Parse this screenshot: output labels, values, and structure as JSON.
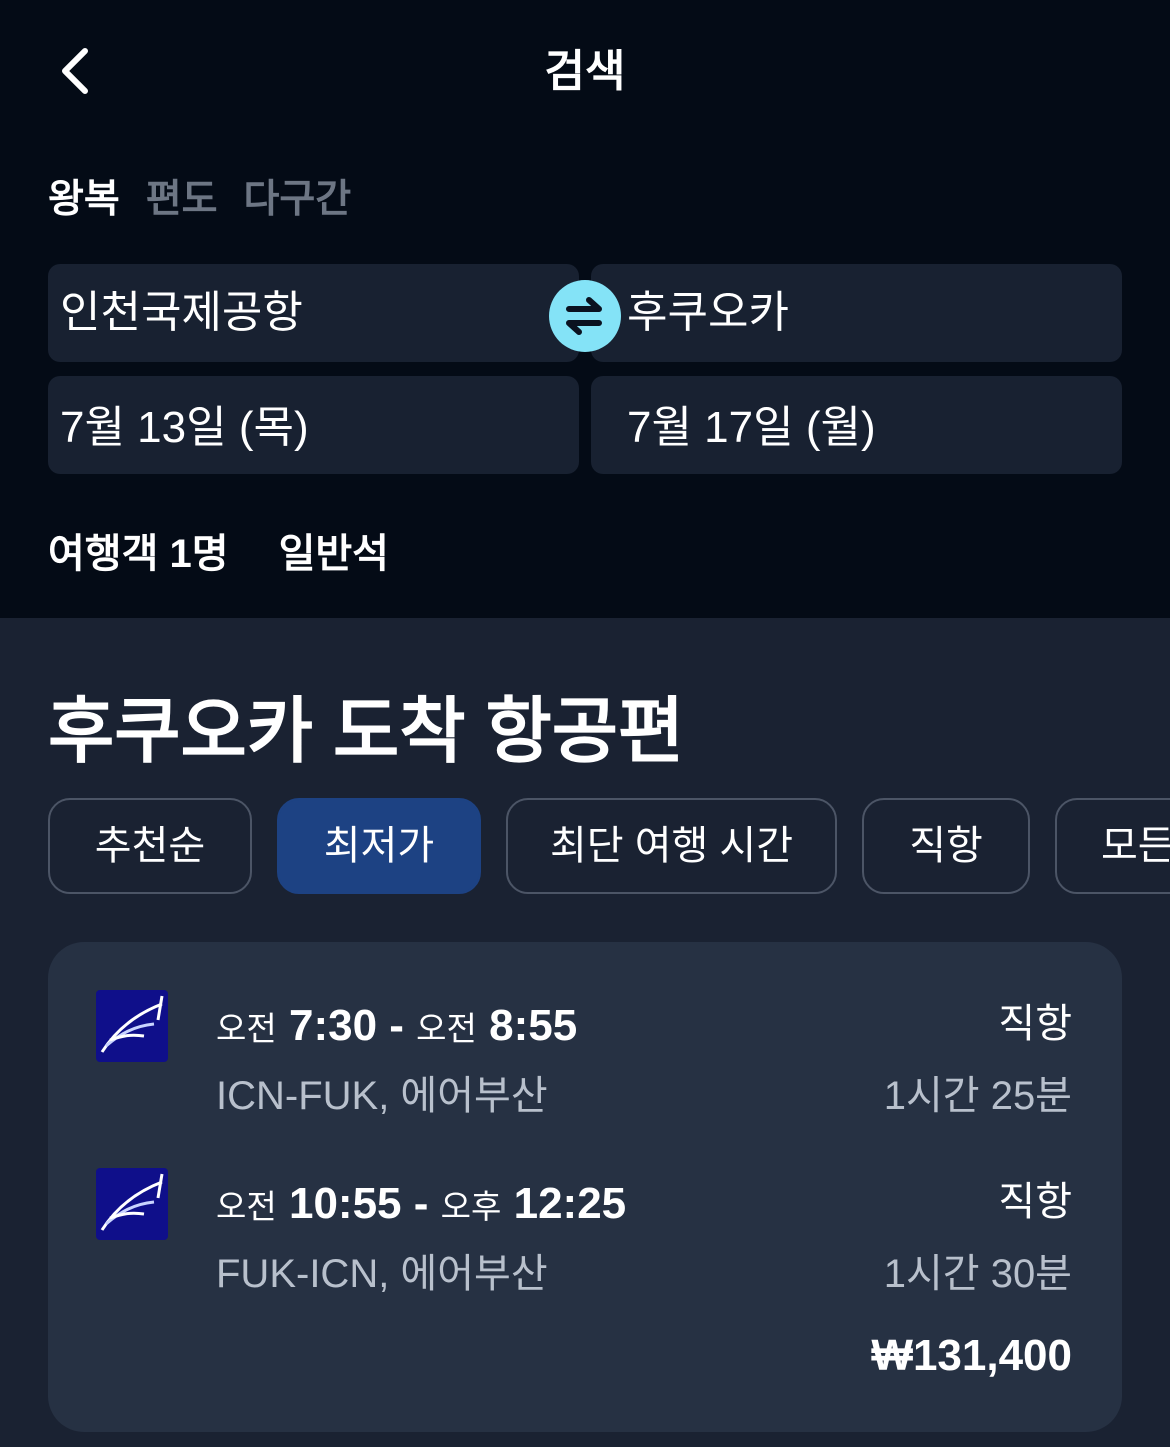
{
  "header": {
    "title": "검색"
  },
  "trip_types": [
    {
      "label": "왕복",
      "active": true
    },
    {
      "label": "편도",
      "active": false
    },
    {
      "label": "다구간",
      "active": false
    }
  ],
  "search": {
    "origin": "인천국제공항",
    "destination": "후쿠오카",
    "depart_date": "7월 13일 (목)",
    "return_date": "7월 17일 (월)",
    "travelers": "여행객 1명",
    "cabin": "일반석"
  },
  "results": {
    "title": "후쿠오카 도착 항공편",
    "sort_chips": [
      {
        "label": "추천순",
        "active": false
      },
      {
        "label": "최저가",
        "active": true
      },
      {
        "label": "최단 여행 시간",
        "active": false
      },
      {
        "label": "직항",
        "active": false
      },
      {
        "label": "모든",
        "active": false
      }
    ],
    "flights": [
      {
        "legs": [
          {
            "dep_period": "오전",
            "dep_time": "7:30",
            "arr_period": "오전",
            "arr_time": "8:55",
            "route": "ICN-FUK, 에어부산",
            "stops": "직항",
            "duration": "1시간 25분"
          },
          {
            "dep_period": "오전",
            "dep_time": "10:55",
            "arr_period": "오후",
            "arr_time": "12:25",
            "route": "FUK-ICN, 에어부산",
            "stops": "직항",
            "duration": "1시간 30분"
          }
        ],
        "price": "₩131,400"
      }
    ]
  },
  "colors": {
    "accent_chip": "#1d4283",
    "swap_button": "#84e3f7",
    "card": "#263143",
    "top_bg": "#040b16"
  },
  "icons": {
    "back": "chevron-left-icon",
    "swap": "swap-arrows-icon",
    "airline": "air-busan-logo"
  }
}
